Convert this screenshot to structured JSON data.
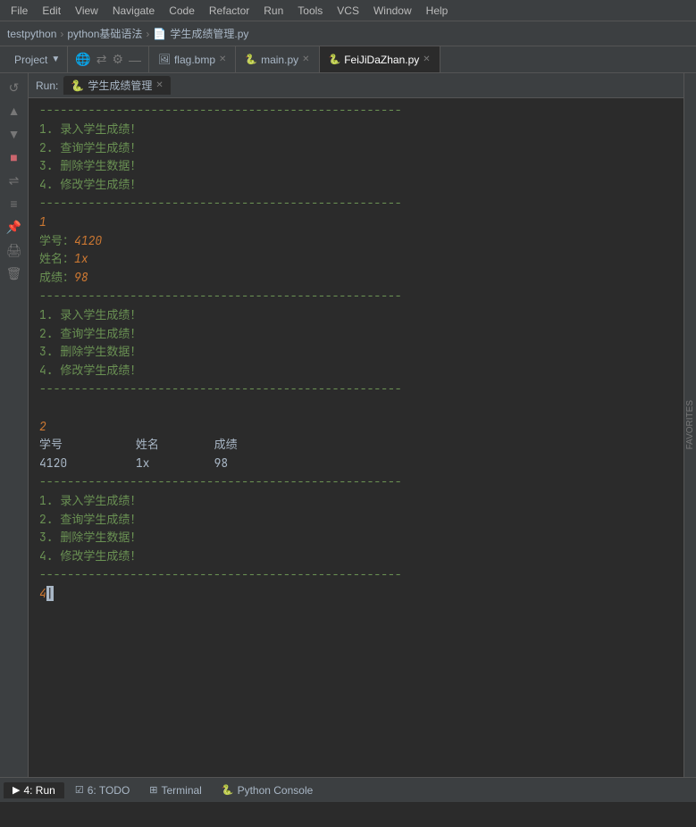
{
  "menubar": {
    "items": [
      "File",
      "Edit",
      "View",
      "Navigate",
      "Code",
      "Refactor",
      "Run",
      "Tools",
      "VCS",
      "Window",
      "Help"
    ]
  },
  "breadcrumb": {
    "items": [
      "testpython",
      "python基础语法",
      "学生成绩管理.py"
    ]
  },
  "tabs": {
    "items": [
      {
        "label": "flag.bmp",
        "icon": "🖼"
      },
      {
        "label": "main.py",
        "icon": "🐍"
      },
      {
        "label": "FeiJiDaZhan.py",
        "icon": "🐍"
      }
    ]
  },
  "project_panel": {
    "label": "Project",
    "dropdown_icon": "▼"
  },
  "run_panel": {
    "run_label": "Run:",
    "tab_label": "学生成绩管理",
    "tab_icon": "🐍"
  },
  "console": {
    "divider": "----------------------------------------------------",
    "menu_items": [
      "1. 录入学生成绩！",
      "2. 查询学生成绩！",
      "3. 删除学生数据！",
      "4. 修改学生成绩！"
    ],
    "sections": [
      {
        "type": "menu"
      },
      {
        "type": "data",
        "choice": "1",
        "xue_hao_label": "学号：",
        "xue_hao_val": "4120",
        "xing_ming_label": "姓名：",
        "xing_ming_val": "1x",
        "cheng_ji_label": "成绩：",
        "cheng_ji_val": "98"
      },
      {
        "type": "menu"
      },
      {
        "type": "table",
        "choice": "2",
        "headers": [
          "学号",
          "姓名",
          "成绩"
        ],
        "rows": [
          [
            "4120",
            "1x",
            "98"
          ]
        ]
      },
      {
        "type": "menu"
      },
      {
        "type": "input",
        "choice": "4"
      }
    ]
  },
  "bottom_tabs": [
    {
      "label": "4: Run",
      "icon": "▶",
      "active": true
    },
    {
      "label": "6: TODO",
      "icon": "☑"
    },
    {
      "label": "Terminal",
      "icon": "⊞"
    },
    {
      "label": "Python Console",
      "icon": "🐍"
    }
  ]
}
